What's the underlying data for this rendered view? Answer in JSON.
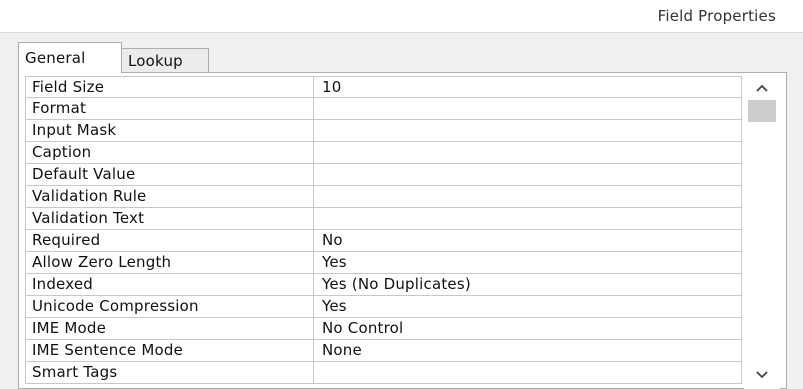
{
  "header": {
    "title": "Field Properties"
  },
  "tabs": [
    {
      "label": "General",
      "selected": true
    },
    {
      "label": "Lookup",
      "selected": false
    }
  ],
  "properties": [
    {
      "name": "Field Size",
      "value": "10"
    },
    {
      "name": "Format",
      "value": ""
    },
    {
      "name": "Input Mask",
      "value": ""
    },
    {
      "name": "Caption",
      "value": ""
    },
    {
      "name": "Default Value",
      "value": ""
    },
    {
      "name": "Validation Rule",
      "value": ""
    },
    {
      "name": "Validation Text",
      "value": ""
    },
    {
      "name": "Required",
      "value": "No"
    },
    {
      "name": "Allow Zero Length",
      "value": "Yes"
    },
    {
      "name": "Indexed",
      "value": "Yes (No Duplicates)"
    },
    {
      "name": "Unicode Compression",
      "value": "Yes"
    },
    {
      "name": "IME Mode",
      "value": "No Control"
    },
    {
      "name": "IME Sentence Mode",
      "value": "None"
    },
    {
      "name": "Smart Tags",
      "value": ""
    }
  ],
  "scrollbar": {
    "up_icon": "chevron-up-icon",
    "down_icon": "chevron-down-icon"
  }
}
